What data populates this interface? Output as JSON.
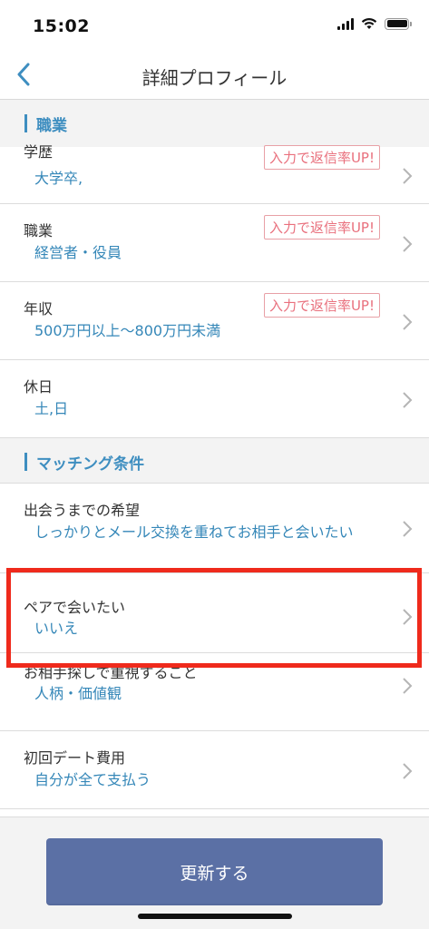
{
  "status": {
    "time": "15:02"
  },
  "nav": {
    "title": "詳細プロフィール"
  },
  "sections": {
    "work": {
      "title": "職業"
    },
    "matching": {
      "title": "マッチング条件"
    }
  },
  "rows": {
    "education": {
      "label": "学歴",
      "value": "大学卒,",
      "badge": "入力で返信率UP!"
    },
    "occupation": {
      "label": "職業",
      "value": "経営者・役員",
      "badge": "入力で返信率UP!"
    },
    "income": {
      "label": "年収",
      "value": "500万円以上〜800万円未満",
      "badge": "入力で返信率UP!"
    },
    "holiday": {
      "label": "休日",
      "value": "土,日"
    },
    "meeting_wish": {
      "label": "出会うまでの希望",
      "value": "しっかりとメール交換を重ねてお相手と会いたい"
    },
    "pair": {
      "label": "ペアで会いたい",
      "value": "いいえ"
    },
    "priority": {
      "label": "お相手探しで重視すること",
      "value": "人柄・価値観"
    },
    "first_date_cost": {
      "label": "初回デート費用",
      "value": "自分が全て支払う"
    }
  },
  "footer": {
    "update_label": "更新する"
  },
  "colors": {
    "accent": "#3e8ec0",
    "value_text": "#3587b8",
    "badge": "#e9707d",
    "button": "#5b70a5",
    "highlight": "#ef2a1c"
  },
  "icons": {
    "back": "chevron-left-icon",
    "row": "chevron-right-icon"
  }
}
